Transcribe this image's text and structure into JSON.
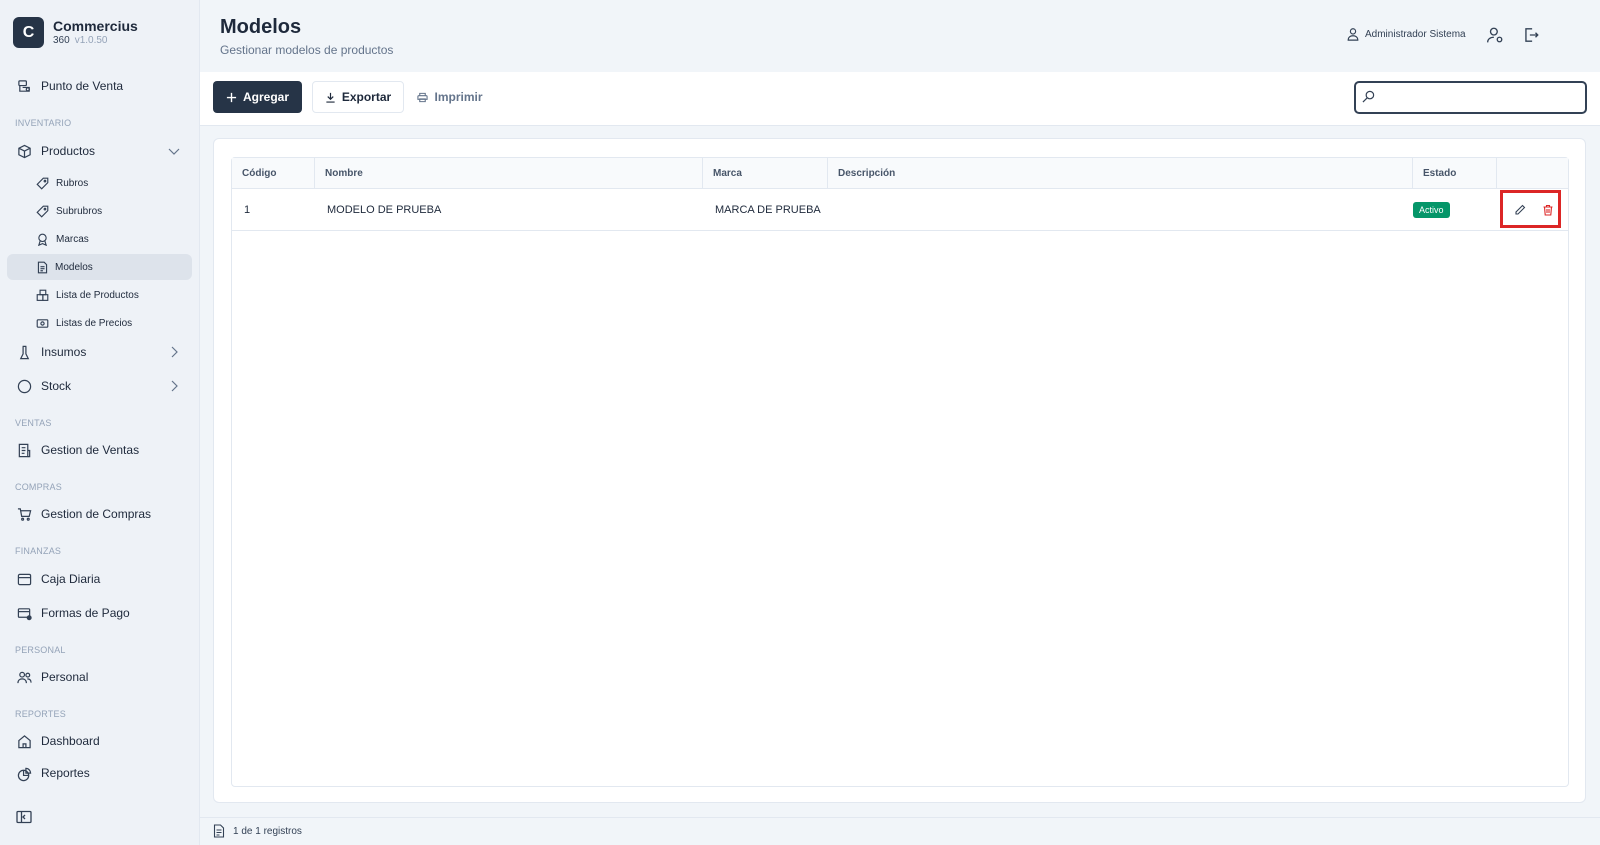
{
  "brand": {
    "logo_letter": "C",
    "name": "Commercius",
    "edition": "360",
    "version": "v1.0.50"
  },
  "sidebar": {
    "items": [
      {
        "label": "Punto de Venta",
        "icon": "pos-icon"
      },
      {
        "section": "INVENTARIO"
      },
      {
        "label": "Productos",
        "icon": "box-icon",
        "expanded": true
      },
      {
        "label": "Rubros",
        "icon": "tag-icon"
      },
      {
        "label": "Subrubros",
        "icon": "tag-icon"
      },
      {
        "label": "Marcas",
        "icon": "award-icon"
      },
      {
        "label": "Modelos",
        "icon": "document-icon",
        "active": true
      },
      {
        "label": "Lista de Productos",
        "icon": "boxes-icon"
      },
      {
        "label": "Listas de Precios",
        "icon": "banknote-icon"
      },
      {
        "label": "Insumos",
        "icon": "flask-icon"
      },
      {
        "label": "Stock",
        "icon": "circle-icon"
      },
      {
        "section": "VENTAS"
      },
      {
        "label": "Gestion de Ventas",
        "icon": "receipt-icon"
      },
      {
        "section": "COMPRAS"
      },
      {
        "label": "Gestion de Compras",
        "icon": "cart-icon"
      },
      {
        "section": "FINANZAS"
      },
      {
        "label": "Caja Diaria",
        "icon": "wallet-icon"
      },
      {
        "label": "Formas de Pago",
        "icon": "card-icon"
      },
      {
        "section": "PERSONAL"
      },
      {
        "label": "Personal",
        "icon": "users-icon"
      },
      {
        "section": "REPORTES"
      },
      {
        "label": "Dashboard",
        "icon": "home-icon"
      },
      {
        "label": "Reportes",
        "icon": "chart-icon"
      }
    ]
  },
  "header": {
    "title": "Modelos",
    "subtitle": "Gestionar modelos de productos",
    "user_name": "Administrador Sistema"
  },
  "toolbar": {
    "add_label": "Agregar",
    "export_label": "Exportar",
    "print_label": "Imprimir",
    "search_placeholder": ""
  },
  "table": {
    "columns": [
      "Código",
      "Nombre",
      "Marca",
      "Descripción",
      "Estado",
      ""
    ],
    "rows": [
      {
        "codigo": "1",
        "nombre": "MODELO DE PRUEBA",
        "marca": "MARCA DE PRUEBA",
        "descripcion": "",
        "estado": "Activo"
      }
    ]
  },
  "footer": {
    "count": "1 de 1 registros"
  },
  "colors": {
    "primary": "#263447",
    "active_badge": "#059669",
    "highlight": "#dc2626",
    "delete": "#dc2626"
  }
}
